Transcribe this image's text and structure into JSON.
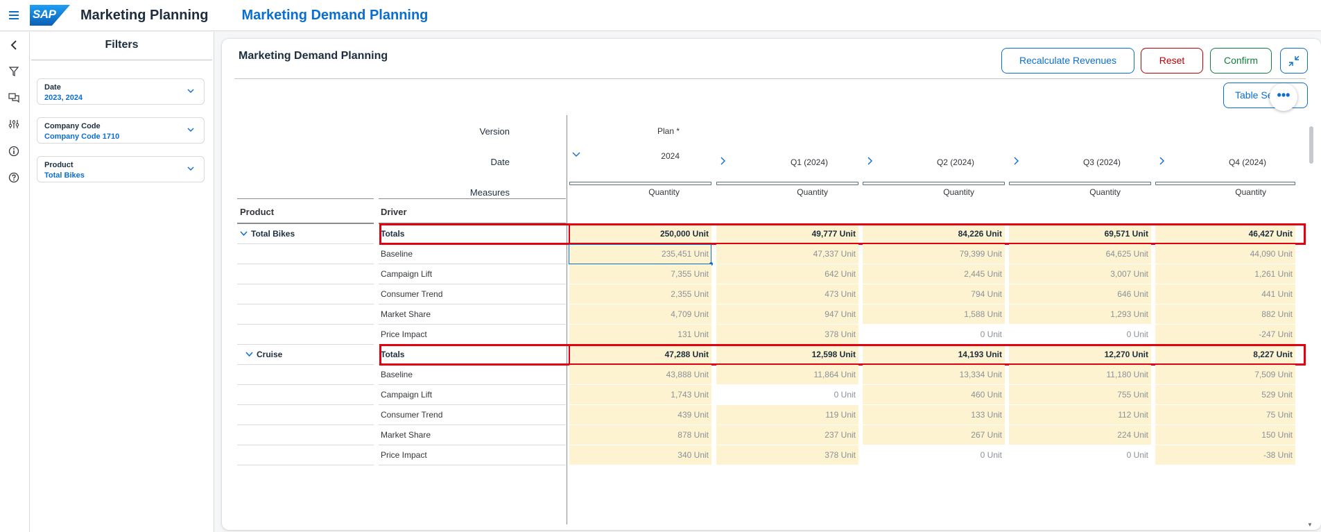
{
  "shell": {
    "app_title": "Marketing Planning",
    "page_title": "Marketing Demand Planning",
    "logo_text": "SAP"
  },
  "rail_icons": [
    "back-icon",
    "filter-icon",
    "comments-icon",
    "settings-icon",
    "info-icon",
    "help-icon"
  ],
  "filters": {
    "title": "Filters",
    "items": [
      {
        "label": "Date",
        "value": "2023, 2024"
      },
      {
        "label": "Company Code",
        "value": "Company Code 1710"
      },
      {
        "label": "Product",
        "value": "Total Bikes"
      }
    ]
  },
  "card": {
    "title": "Marketing Demand Planning",
    "buttons": {
      "recalc": "Recalculate Revenues",
      "reset": "Reset",
      "confirm": "Confirm",
      "table_settings": "Table Se"
    },
    "more": "•••"
  },
  "table": {
    "labels": {
      "version": "Version",
      "date": "Date",
      "measures": "Measures",
      "product": "Product",
      "driver": "Driver"
    },
    "version_value": "Plan *",
    "date_year": "2024",
    "columns": [
      "2024",
      "Q1 (2024)",
      "Q2 (2024)",
      "Q3 (2024)",
      "Q4 (2024)"
    ],
    "measure": "Quantity",
    "groups": [
      {
        "product": "Total Bikes",
        "rows": [
          {
            "driver": "Totals",
            "values": [
              "250,000 Unit",
              "49,777 Unit",
              "84,226 Unit",
              "69,571 Unit",
              "46,427 Unit"
            ]
          },
          {
            "driver": "Baseline",
            "values": [
              "235,451 Unit",
              "47,337 Unit",
              "79,399 Unit",
              "64,625 Unit",
              "44,090 Unit"
            ]
          },
          {
            "driver": "Campaign Lift",
            "values": [
              "7,355 Unit",
              "642 Unit",
              "2,445 Unit",
              "3,007 Unit",
              "1,261 Unit"
            ]
          },
          {
            "driver": "Consumer Trend",
            "values": [
              "2,355 Unit",
              "473 Unit",
              "794 Unit",
              "646 Unit",
              "441 Unit"
            ]
          },
          {
            "driver": "Market Share",
            "values": [
              "4,709 Unit",
              "947 Unit",
              "1,588 Unit",
              "1,293 Unit",
              "882 Unit"
            ]
          },
          {
            "driver": "Price Impact",
            "values": [
              "131 Unit",
              "378 Unit",
              "0 Unit",
              "0 Unit",
              "-247 Unit"
            ]
          }
        ]
      },
      {
        "product": "Cruise",
        "rows": [
          {
            "driver": "Totals",
            "values": [
              "47,288 Unit",
              "12,598 Unit",
              "14,193 Unit",
              "12,270 Unit",
              "8,227 Unit"
            ]
          },
          {
            "driver": "Baseline",
            "values": [
              "43,888 Unit",
              "11,864 Unit",
              "13,334 Unit",
              "11,180 Unit",
              "7,509 Unit"
            ]
          },
          {
            "driver": "Campaign Lift",
            "values": [
              "1,743 Unit",
              "0 Unit",
              "460 Unit",
              "755 Unit",
              "529 Unit"
            ]
          },
          {
            "driver": "Consumer Trend",
            "values": [
              "439 Unit",
              "119 Unit",
              "133 Unit",
              "112 Unit",
              "75 Unit"
            ]
          },
          {
            "driver": "Market Share",
            "values": [
              "878 Unit",
              "237 Unit",
              "267 Unit",
              "224 Unit",
              "150 Unit"
            ]
          },
          {
            "driver": "Price Impact",
            "values": [
              "340 Unit",
              "378 Unit",
              "0 Unit",
              "0 Unit",
              "-38 Unit"
            ]
          }
        ]
      }
    ]
  }
}
